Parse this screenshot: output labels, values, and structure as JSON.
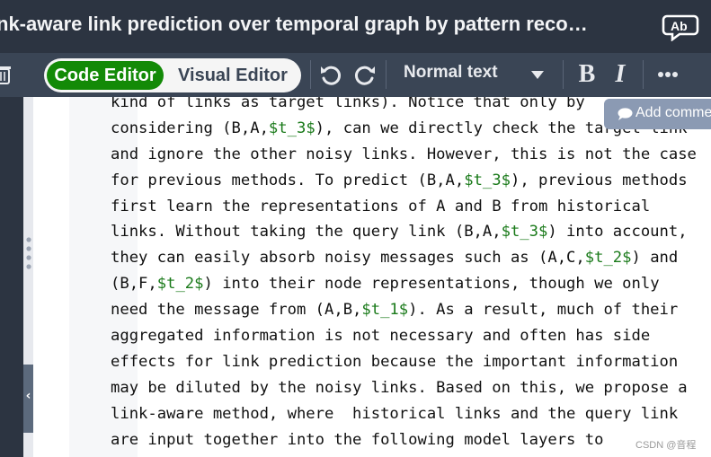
{
  "header": {
    "title": "nk-aware link prediction over temporal graph by pattern reco…",
    "review_icon": "review-ab-icon",
    "review_icon_text": "Ab"
  },
  "toolbar": {
    "trash_icon": "trash-icon",
    "mode_toggle": {
      "code_label": "Code Editor",
      "visual_label": "Visual Editor",
      "active": "Code Editor"
    },
    "undo_icon": "undo-icon",
    "redo_icon": "redo-icon",
    "format_select": {
      "value": "Normal text"
    },
    "bold_label": "B",
    "italic_label": "I",
    "more_icon": "more-horizontal-icon"
  },
  "sidebar": {
    "collapse_glyph": "‹"
  },
  "editor": {
    "lines": [
      [
        {
          "t": "kind of links as target links). Notice that only by"
        }
      ],
      [
        {
          "t": "considering (B,A,"
        },
        {
          "t": "$t_3$",
          "math": true
        },
        {
          "t": "), can we directly check the target link"
        }
      ],
      [
        {
          "t": "and ignore the other noisy links. However, this is not the case"
        }
      ],
      [
        {
          "t": "for previous methods. To predict (B,A,"
        },
        {
          "t": "$t_3$",
          "math": true
        },
        {
          "t": "), previous methods"
        }
      ],
      [
        {
          "t": "first learn the representations of A and B from historical"
        }
      ],
      [
        {
          "t": "links. Without taking the query link (B,A,"
        },
        {
          "t": "$t_3$",
          "math": true
        },
        {
          "t": ") into account,"
        }
      ],
      [
        {
          "t": "they can easily absorb noisy messages such as (A,C,"
        },
        {
          "t": "$t_2$",
          "math": true
        },
        {
          "t": ") and"
        }
      ],
      [
        {
          "t": "(B,F,"
        },
        {
          "t": "$t_2$",
          "math": true
        },
        {
          "t": ") into their node representations, though we only"
        }
      ],
      [
        {
          "t": "need the message from (A,B,"
        },
        {
          "t": "$t_1$",
          "math": true
        },
        {
          "t": "). As a result, much of their"
        }
      ],
      [
        {
          "t": "aggregated information is not necessary and often has side"
        }
      ],
      [
        {
          "t": "effects for link prediction because the important information"
        }
      ],
      [
        {
          "t": "may be diluted by the noisy links. Based on this, we propose a"
        }
      ],
      [
        {
          "t": "link-aware method, where  historical links and the query link"
        }
      ],
      [
        {
          "t": "are input together into the following model layers to"
        }
      ]
    ],
    "add_comment_label": "Add comme",
    "add_comment_icon": "comment-bubble-icon"
  },
  "watermark": "CSDN @音程",
  "colors": {
    "title_bar": "#2c3441",
    "toolbar": "#3a4555",
    "active_toggle": "#138a07",
    "math_text": "#1a7a1a",
    "add_comment": "#8b9ab3"
  }
}
